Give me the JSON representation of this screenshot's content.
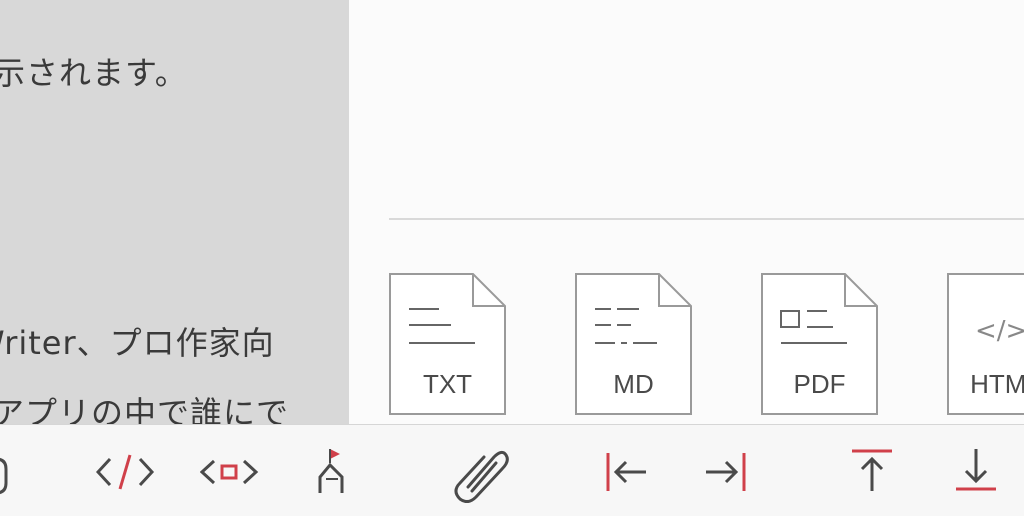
{
  "document": {
    "lines": [
      "表示されます。",
      "Writer、プロ作家向",
      "アプリの中で誰にで"
    ]
  },
  "export_formats": [
    {
      "label": "TXT",
      "icon": "txt-file-icon"
    },
    {
      "label": "MD",
      "icon": "md-file-icon"
    },
    {
      "label": "PDF",
      "icon": "pdf-file-icon"
    },
    {
      "label": "HTML",
      "icon": "html-file-icon"
    }
  ],
  "html_glyph": "</>",
  "toolbar": {
    "items": [
      "code-tag-icon",
      "preview-tag-icon",
      "tag-person-icon",
      "attachment-icon",
      "jump-to-line-start-icon",
      "jump-to-line-end-icon",
      "jump-to-top-icon",
      "jump-to-bottom-icon"
    ]
  },
  "colors": {
    "accent": "#d0404a",
    "icon": "#4a4a4a",
    "file_outline": "#9a9a9a"
  }
}
